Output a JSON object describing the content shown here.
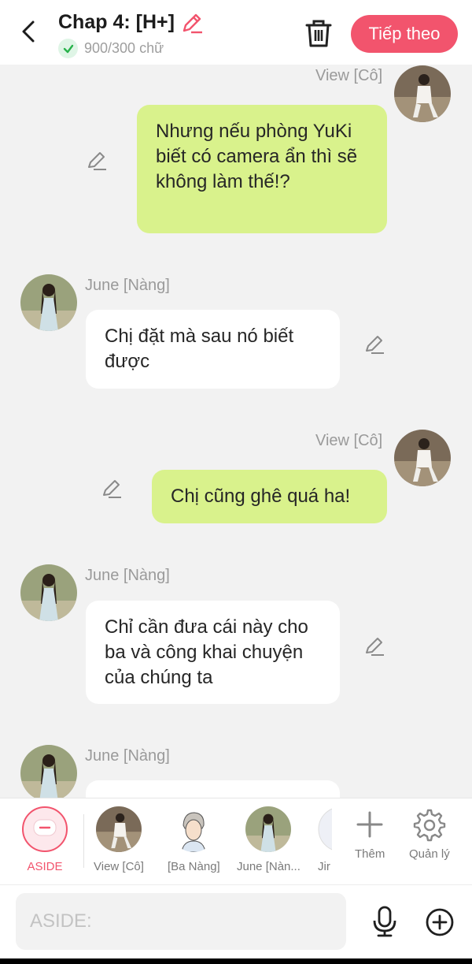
{
  "header": {
    "title": "Chap 4: [H+]",
    "word_count": "900/300 chữ",
    "next_label": "Tiếp theo"
  },
  "colors": {
    "accent": "#f2546d",
    "bubble_self": "#d9f28c",
    "bubble_other": "#ffffff"
  },
  "messages": [
    {
      "sender": "View [Cô]",
      "side": "right",
      "text": "Nhưng nếu phòng YuKi biết có camera ẩn thì sẽ không làm thế!?"
    },
    {
      "sender": "June [Nàng]",
      "side": "left",
      "text": "Chị đặt mà sau nó biết được"
    },
    {
      "sender": "View [Cô]",
      "side": "right",
      "text": "Chị cũng ghê quá ha!"
    },
    {
      "sender": "June [Nàng]",
      "side": "left",
      "text": "Chỉ cần đưa cái này cho ba và công khai chuyện của chúng ta"
    },
    {
      "sender": "June [Nàng]",
      "side": "left",
      "text": ""
    }
  ],
  "characters": [
    {
      "label": "ASIDE"
    },
    {
      "label": "View [Cô]"
    },
    {
      "label": "[Ba Nàng]"
    },
    {
      "label": "June [Nàn..."
    },
    {
      "label": "Jir"
    }
  ],
  "tools": {
    "add_label": "Thêm",
    "manage_label": "Quản lý"
  },
  "input": {
    "placeholder": "ASIDE:"
  }
}
